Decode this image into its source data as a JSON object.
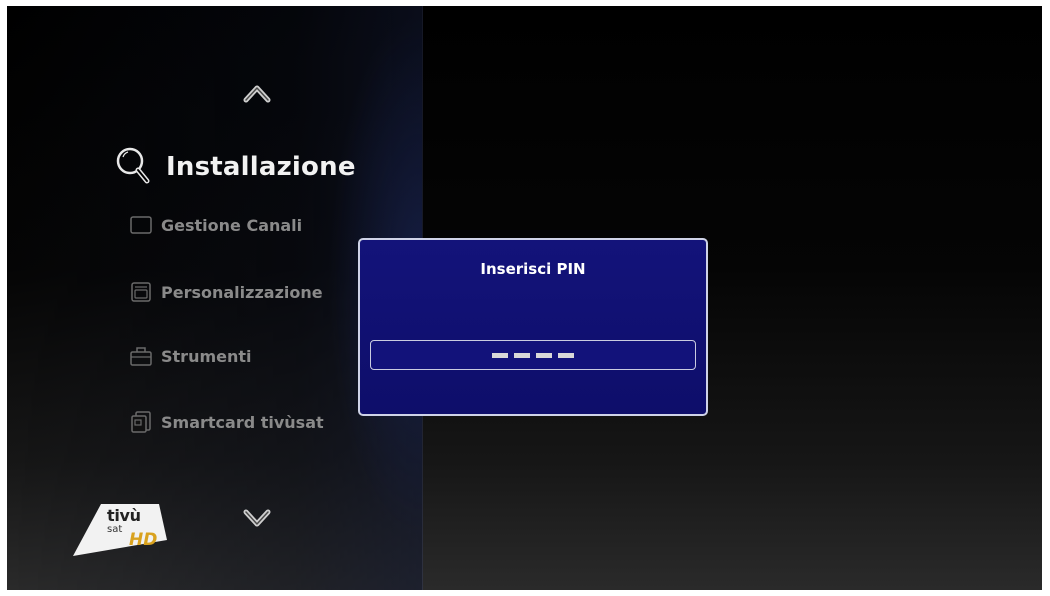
{
  "menu": {
    "title": "Installazione",
    "items": [
      {
        "label": "Gestione Canali",
        "icon": "channel-box-icon"
      },
      {
        "label": "Personalizzazione",
        "icon": "customize-icon"
      },
      {
        "label": "Strumenti",
        "icon": "toolbox-icon"
      },
      {
        "label": "Smartcard tivùsat",
        "icon": "smartcard-icon"
      }
    ],
    "nav": {
      "up_icon": "chevron-up-icon",
      "down_icon": "chevron-down-icon"
    }
  },
  "dialog": {
    "title": "Inserisci PIN",
    "pin_masked_digits": 4
  },
  "logo": {
    "main": "tivù",
    "sub": "sat",
    "hd": "HD"
  },
  "colors": {
    "dialog_bg": "#13137a",
    "dialog_border": "#cfd3e8",
    "menu_text_inactive": "#8a8a8a",
    "menu_title": "#f2f2f2",
    "hd_gold": "#d9a21f"
  }
}
